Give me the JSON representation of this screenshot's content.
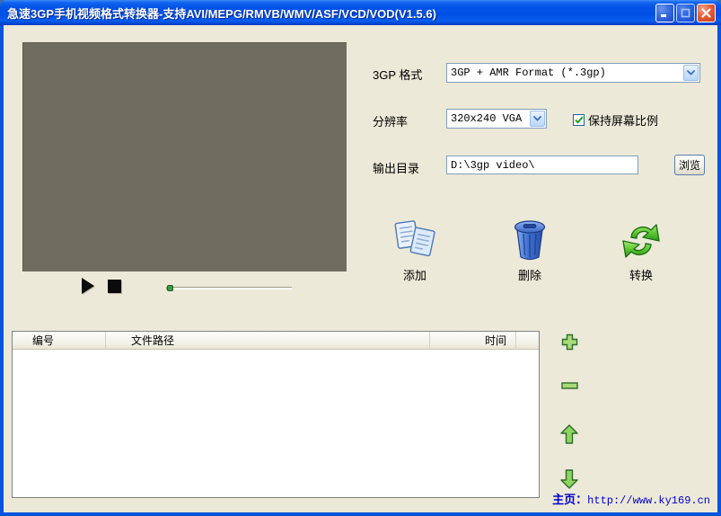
{
  "window": {
    "title": "急速3GP手机视频格式转换器-支持AVI/MEPG/RMVB/WMV/ASF/VCD/VOD(V1.5.6)"
  },
  "settings": {
    "format_label": "3GP 格式",
    "format_value": "3GP + AMR Format (*.3gp)",
    "resolution_label": "分辨率",
    "resolution_value": "320x240 VGA",
    "keep_ratio_label": "保持屏幕比例",
    "output_label": "输出目录",
    "output_value": "D:\\3gp video\\",
    "browse_label": "浏览"
  },
  "actions": {
    "add_label": "添加",
    "delete_label": "删除",
    "convert_label": "转换"
  },
  "file_table": {
    "columns": [
      "编号",
      "文件路径",
      "时间"
    ],
    "rows": []
  },
  "footer": {
    "homepage_label": "主页：",
    "homepage_url": "http://www.ky169.cn"
  },
  "colors": {
    "titlebar_blue": "#0050E6",
    "client_bg": "#ECE9D8",
    "preview_bg": "#6F6D5F",
    "accent_green": "#9ACD5A",
    "link_blue": "#0000CC"
  }
}
